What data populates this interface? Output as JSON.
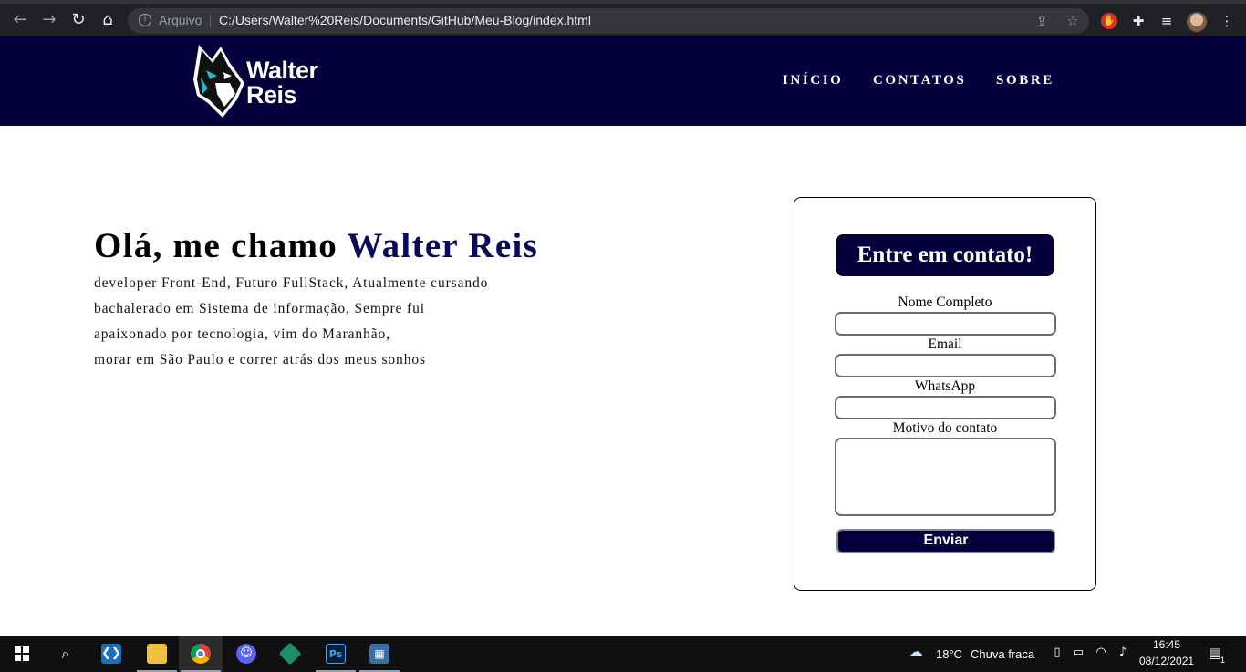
{
  "browser": {
    "back_icon": "arrow-left-icon",
    "forward_icon": "arrow-right-icon",
    "reload_icon": "reload-icon",
    "home_icon": "home-icon",
    "address_label": "Arquivo",
    "url": "C:/Users/Walter%20Reis/Documents/GitHub/Meu-Blog/index.html"
  },
  "site": {
    "logo_line1": "Walter",
    "logo_line2": "Reis",
    "nav": [
      "INÍCIO",
      "CONTATOS",
      "SOBRE"
    ],
    "colors": {
      "header_bg": "#04003c",
      "accent": "#0a0a5a"
    }
  },
  "hero": {
    "title_prefix": "Olá, me chamo ",
    "title_name": "Walter Reis",
    "lines": [
      "developer Front-End, Futuro FullStack, Atualmente cursando",
      "bachalerado em Sistema de informação, Sempre fui",
      "apaixonado por tecnologia, vim do Maranhão,",
      "morar em São Paulo e correr atrás dos meus sonhos"
    ]
  },
  "contact": {
    "title": "Entre em contato!",
    "fields": [
      "Nome Completo",
      "Email",
      "WhatsApp",
      "Motivo do contato"
    ],
    "values": [
      "",
      "",
      "",
      ""
    ],
    "submit_label": "Enviar"
  },
  "taskbar": {
    "apps": [
      "windows-start",
      "search",
      "vscode",
      "file-explorer",
      "chrome",
      "discord",
      "git-kraken",
      "photoshop",
      "calculator"
    ],
    "weather_temp": "18°C",
    "weather_text": "Chuva fraca",
    "time": "16:45",
    "date": "08/12/2021",
    "notifications": "1"
  }
}
